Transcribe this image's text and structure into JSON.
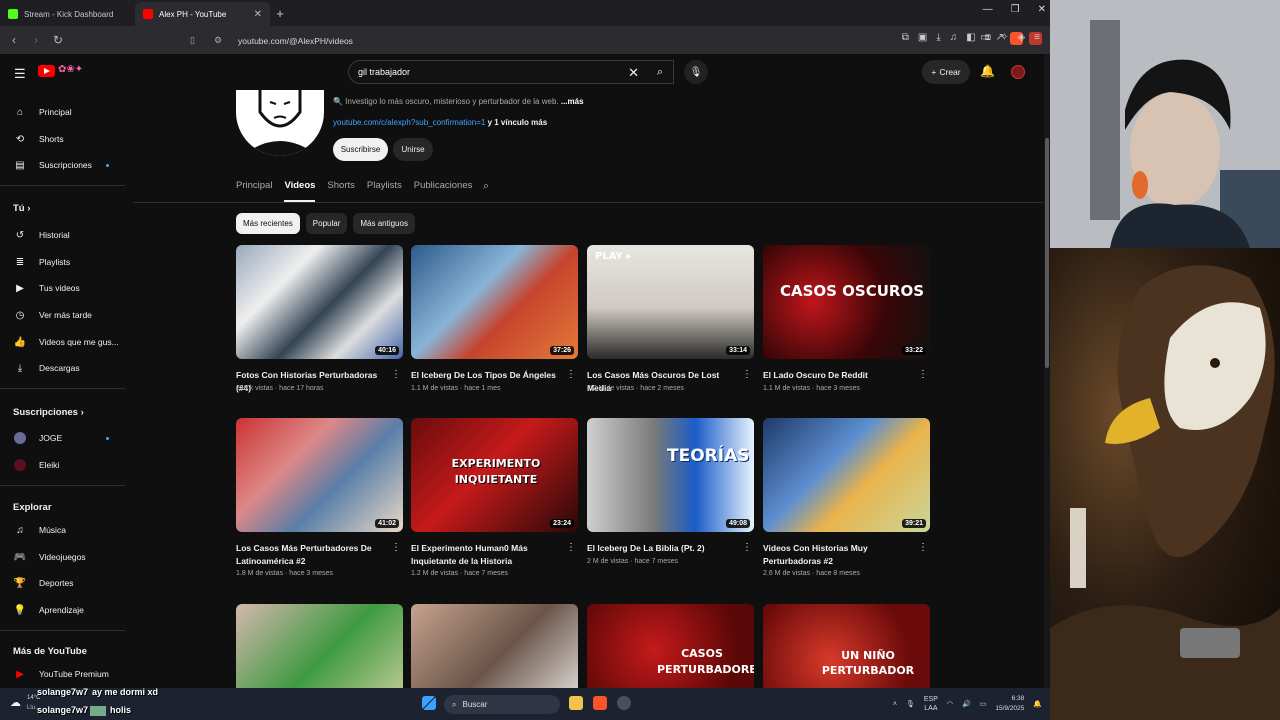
{
  "browser": {
    "tabs": [
      {
        "title": "Stream - Kick Dashboard",
        "color": "#53fc18"
      },
      {
        "title": "Alex PH - YouTube",
        "color": "#ff0000"
      }
    ],
    "url": "youtube.com/@AlexPH/videos"
  },
  "masthead": {
    "search_value": "gil trabajador",
    "create_label": "Crear"
  },
  "sidebar": {
    "main": [
      {
        "label": "Principal",
        "icon": "home-icon"
      },
      {
        "label": "Shorts",
        "icon": "shorts-icon"
      },
      {
        "label": "Suscripciones",
        "icon": "subscriptions-icon"
      }
    ],
    "you_header": "Tú",
    "you": [
      {
        "label": "Historial",
        "icon": "history-icon"
      },
      {
        "label": "Playlists",
        "icon": "playlists-icon"
      },
      {
        "label": "Tus videos",
        "icon": "your-videos-icon"
      },
      {
        "label": "Ver más tarde",
        "icon": "watch-later-icon"
      },
      {
        "label": "Videos que me gus...",
        "icon": "like-icon"
      },
      {
        "label": "Descargas",
        "icon": "download-icon"
      }
    ],
    "subs_header": "Suscripciones",
    "subs": [
      {
        "label": "JOGE"
      },
      {
        "label": "Eleiki"
      }
    ],
    "explore_header": "Explorar",
    "explore": [
      {
        "label": "Música",
        "icon": "music-icon"
      },
      {
        "label": "Videojuegos",
        "icon": "gaming-icon"
      },
      {
        "label": "Deportes",
        "icon": "trophy-icon"
      },
      {
        "label": "Aprendizaje",
        "icon": "lightbulb-icon"
      }
    ],
    "more_header": "Más de YouTube",
    "more": [
      {
        "label": "YouTube Premium",
        "icon": "youtube-premium-icon"
      }
    ]
  },
  "channel": {
    "description_prefix": "🔍 Investigo lo más oscuro, misterioso y perturbador de la web.",
    "description_more": "...más",
    "link": "youtube.com/c/alexph?sub_confirmation=1",
    "link_suffix": "y 1 vínculo más",
    "subscribe_label": "Suscribirse",
    "join_label": "Unirse",
    "tabs": [
      "Principal",
      "Videos",
      "Shorts",
      "Playlists",
      "Publicaciones"
    ],
    "active_tab": "Videos",
    "chips": [
      "Más recientes",
      "Popular",
      "Más antiguos"
    ]
  },
  "videos": [
    {
      "title": "Fotos Con Historias Perturbadoras (#4)",
      "meta": "218 k vistas · hace 17 horas",
      "duration": "40:16",
      "thumb_text": ""
    },
    {
      "title": "El Iceberg De Los Tipos De Ángeles",
      "meta": "1.1 M de vistas · hace 1 mes",
      "duration": "37:26",
      "thumb_text": ""
    },
    {
      "title": "Los Casos Más Oscuros De Lost Media",
      "meta": "2.2 M de vistas · hace 2 meses",
      "duration": "33:14",
      "thumb_text": "PLAY ▸"
    },
    {
      "title": "El Lado Oscuro De Reddit",
      "meta": "1.1 M de vistas · hace 3 meses",
      "duration": "33:22",
      "thumb_text": "CASOS OSCUROS"
    },
    {
      "title": "Los Casos Más Perturbadores De Latinoamérica #2",
      "meta": "1.8 M de vistas · hace 3 meses",
      "duration": "41:02",
      "thumb_text": ""
    },
    {
      "title": "El Experimento Human0 Más Inquietante de la Historia",
      "meta": "1.2 M de vistas · hace 7 meses",
      "duration": "23:24",
      "thumb_text": "EXPERIMENTO INQUIETANTE"
    },
    {
      "title": "El Iceberg De La Biblia (Pt. 2)",
      "meta": "2 M de vistas · hace 7 meses",
      "duration": "49:08",
      "thumb_text": "TEORÍAS"
    },
    {
      "title": "Videos Con Historias Muy Perturbadoras #2",
      "meta": "2.6 M de vistas · hace 8 meses",
      "duration": "39:21",
      "thumb_text": ""
    },
    {
      "title": "",
      "meta": "",
      "duration": "",
      "thumb_text": ""
    },
    {
      "title": "",
      "meta": "",
      "duration": "",
      "thumb_text": ""
    },
    {
      "title": "",
      "meta": "",
      "duration": "",
      "thumb_text": "CASOS PERTURBADORES"
    },
    {
      "title": "",
      "meta": "",
      "duration": "",
      "thumb_text": "UN NIÑO PERTURBADOR"
    }
  ],
  "taskbar": {
    "search_label": "Buscar",
    "lang_top": "ESP",
    "lang_bottom": "LAA",
    "time": "6:38",
    "date": "15/9/2025",
    "weather_temp": "14°C",
    "weather_cond": "Llu..."
  },
  "chat": [
    {
      "user": "solange7w7",
      "message": "ay me dormi xd"
    },
    {
      "user": "solange7w7",
      "message": "holis"
    }
  ]
}
